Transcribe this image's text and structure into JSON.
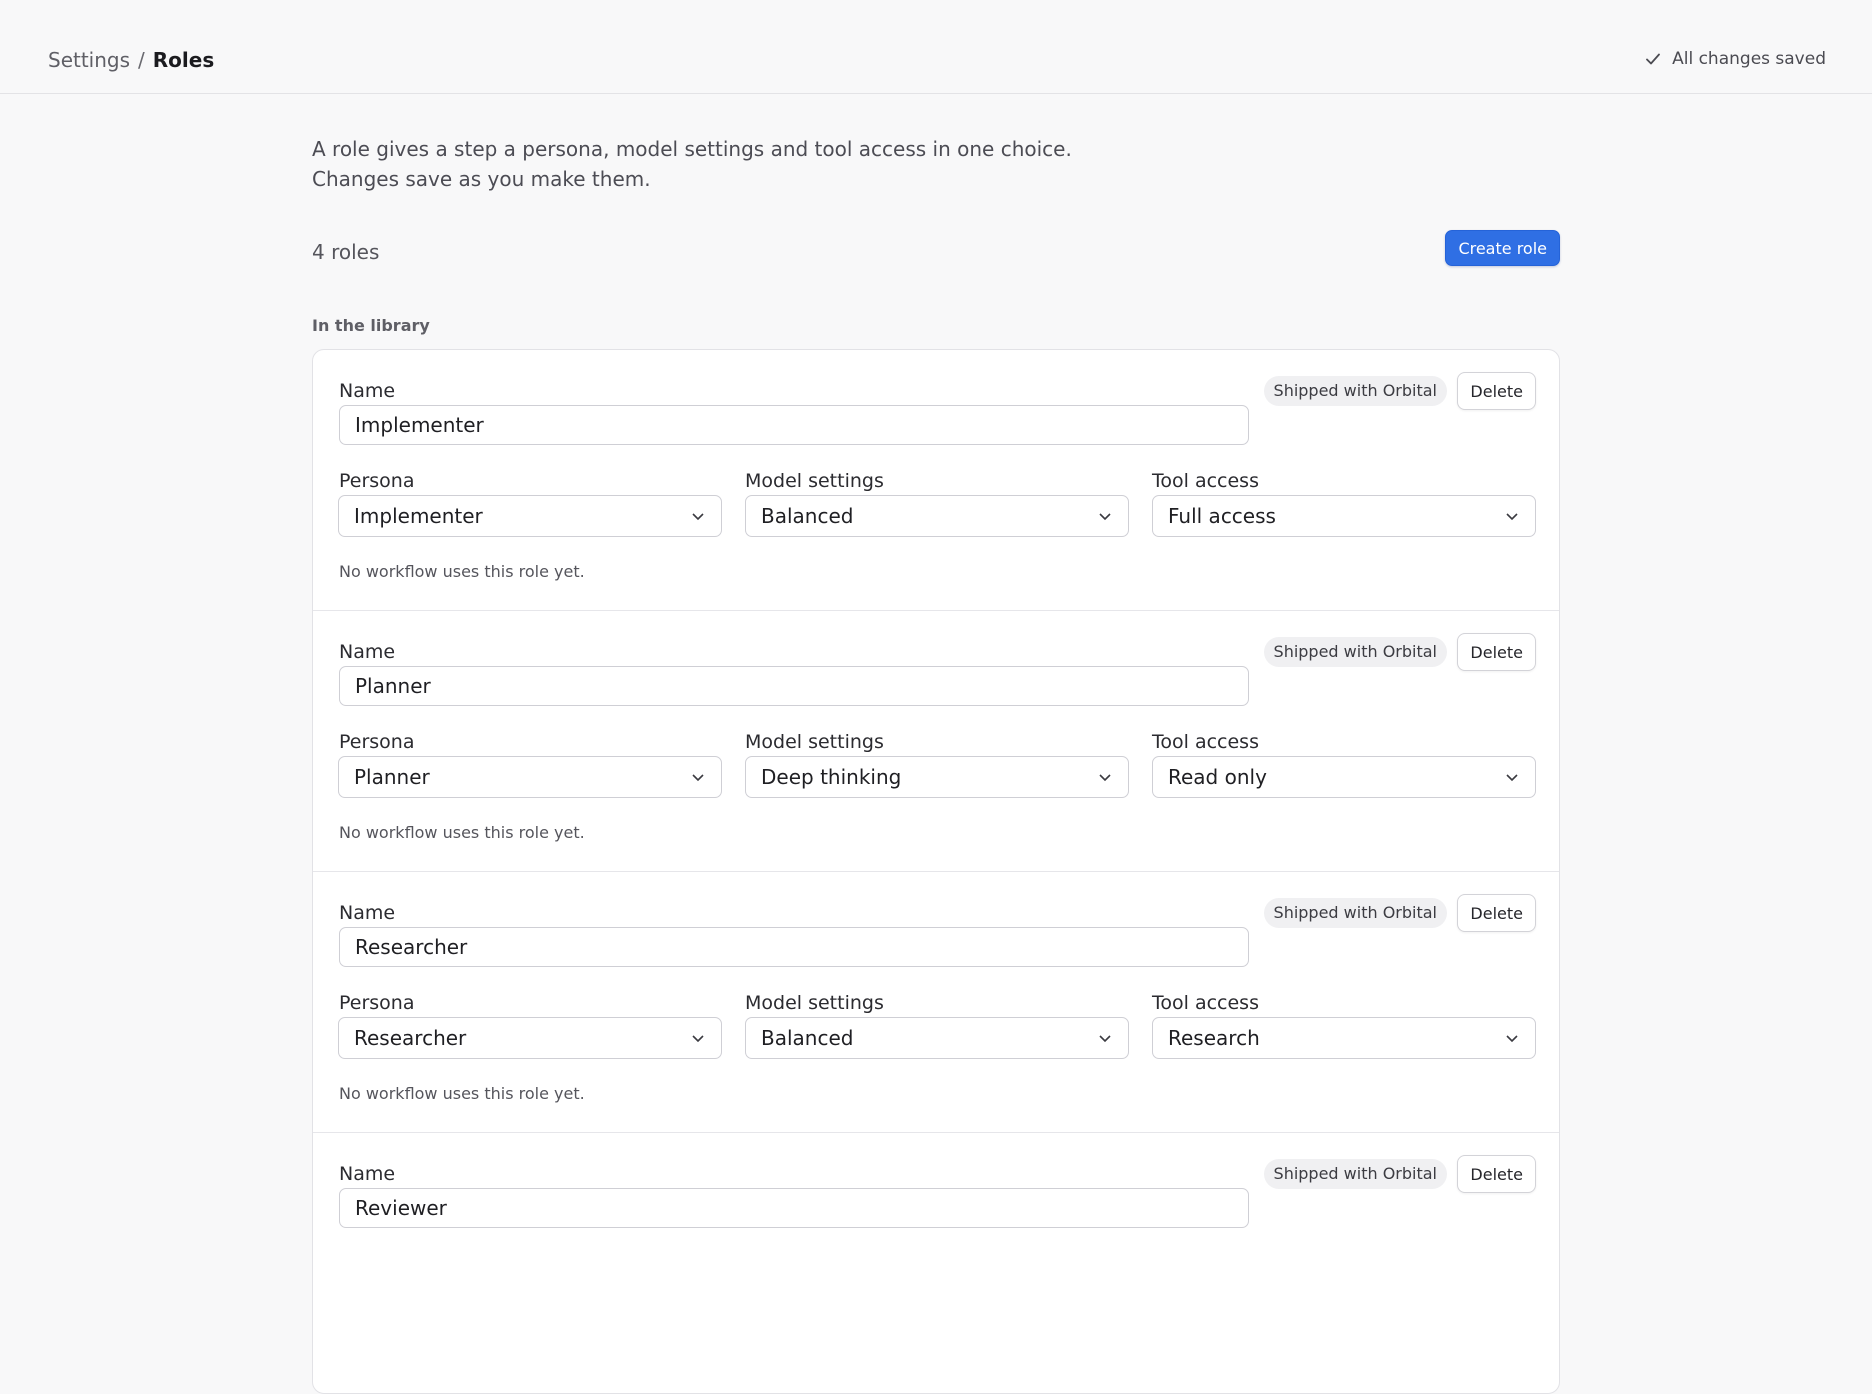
{
  "breadcrumb": {
    "root": "Settings",
    "separator": "/",
    "current": "Roles"
  },
  "status": {
    "text": "All changes saved",
    "icon": "check-icon"
  },
  "intro": "A role gives a step a persona, model settings and tool access in one choice. Changes save as you make them.",
  "count": "4 roles",
  "create_label": "Create role",
  "section_label": "In the library",
  "field_labels": {
    "name": "Name",
    "persona": "Persona",
    "model": "Model settings",
    "tools": "Tool access"
  },
  "badge": "Shipped with Orbital",
  "delete_label": "Delete",
  "roles": [
    {
      "name": "Implementer",
      "persona": "Implementer",
      "model": "Balanced",
      "tools": "Full access",
      "usage": "No workflow uses this role yet."
    },
    {
      "name": "Planner",
      "persona": "Planner",
      "model": "Deep thinking",
      "tools": "Read only",
      "usage": "No workflow uses this role yet."
    },
    {
      "name": "Researcher",
      "persona": "Researcher",
      "model": "Balanced",
      "tools": "Research",
      "usage": "No workflow uses this role yet."
    },
    {
      "name": "Reviewer"
    }
  ]
}
